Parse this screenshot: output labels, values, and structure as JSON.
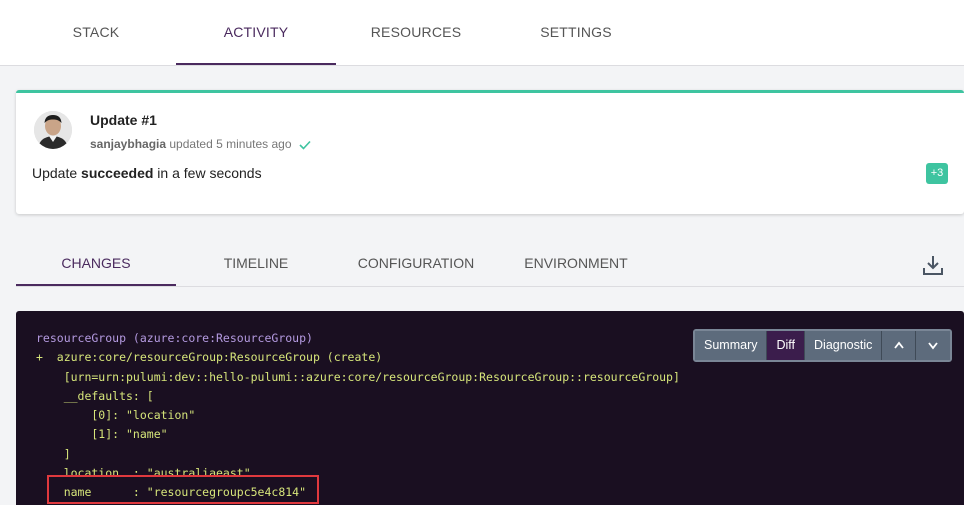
{
  "top_tabs": [
    {
      "label": "STACK"
    },
    {
      "label": "ACTIVITY"
    },
    {
      "label": "RESOURCES"
    },
    {
      "label": "SETTINGS"
    }
  ],
  "update_card": {
    "title": "Update #1",
    "user": "sanjaybhagia",
    "action": "updated",
    "time": "5 minutes ago",
    "summary_prefix": "Update ",
    "summary_status": "succeeded",
    "summary_suffix": " in a few seconds",
    "badge": "+3"
  },
  "sub_tabs": [
    {
      "label": "CHANGES"
    },
    {
      "label": "TIMELINE"
    },
    {
      "label": "CONFIGURATION"
    },
    {
      "label": "ENVIRONMENT"
    }
  ],
  "toolbar": {
    "summary": "Summary",
    "diff": "Diff",
    "diagnostic": "Diagnostic",
    "up": "⌃",
    "down": "⌄"
  },
  "code_lines": [
    "resourceGroup (azure:core:ResourceGroup)",
    "+  azure:core/resourceGroup:ResourceGroup (create)",
    "    [urn=urn:pulumi:dev::hello-pulumi::azure:core/resourceGroup:ResourceGroup::resourceGroup]",
    "    __defaults: [",
    "        [0]: \"location\"",
    "        [1]: \"name\"",
    "    ]",
    "    location  : \"australiaeast\"",
    "    name      : \"resourcegroupc5e4c814\""
  ],
  "colors": {
    "accent": "#4a2a5e",
    "success": "#3ec4a0",
    "code_bg": "#1a0f21",
    "code_resource": "#b49ae0",
    "code_create": "#d6e57a",
    "highlight": "#e0393e"
  }
}
